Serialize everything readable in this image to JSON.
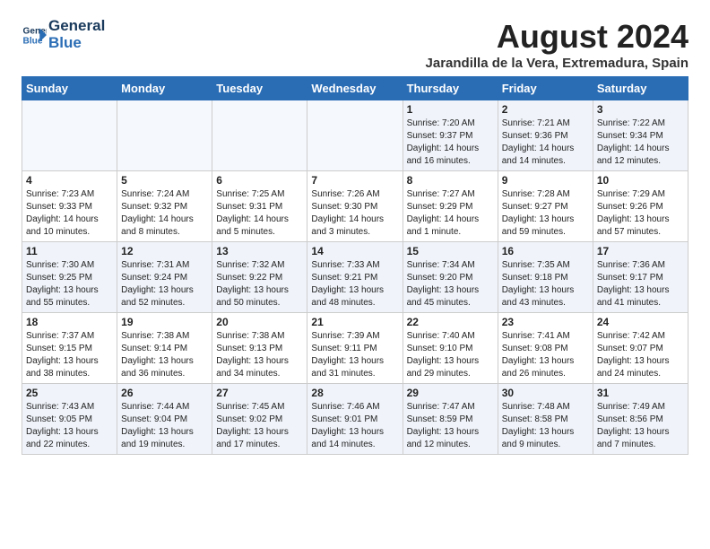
{
  "header": {
    "logo_line1": "General",
    "logo_line2": "Blue",
    "month_title": "August 2024",
    "subtitle": "Jarandilla de la Vera, Extremadura, Spain"
  },
  "weekdays": [
    "Sunday",
    "Monday",
    "Tuesday",
    "Wednesday",
    "Thursday",
    "Friday",
    "Saturday"
  ],
  "weeks": [
    [
      {
        "day": "",
        "info": ""
      },
      {
        "day": "",
        "info": ""
      },
      {
        "day": "",
        "info": ""
      },
      {
        "day": "",
        "info": ""
      },
      {
        "day": "1",
        "info": "Sunrise: 7:20 AM\nSunset: 9:37 PM\nDaylight: 14 hours\nand 16 minutes."
      },
      {
        "day": "2",
        "info": "Sunrise: 7:21 AM\nSunset: 9:36 PM\nDaylight: 14 hours\nand 14 minutes."
      },
      {
        "day": "3",
        "info": "Sunrise: 7:22 AM\nSunset: 9:34 PM\nDaylight: 14 hours\nand 12 minutes."
      }
    ],
    [
      {
        "day": "4",
        "info": "Sunrise: 7:23 AM\nSunset: 9:33 PM\nDaylight: 14 hours\nand 10 minutes."
      },
      {
        "day": "5",
        "info": "Sunrise: 7:24 AM\nSunset: 9:32 PM\nDaylight: 14 hours\nand 8 minutes."
      },
      {
        "day": "6",
        "info": "Sunrise: 7:25 AM\nSunset: 9:31 PM\nDaylight: 14 hours\nand 5 minutes."
      },
      {
        "day": "7",
        "info": "Sunrise: 7:26 AM\nSunset: 9:30 PM\nDaylight: 14 hours\nand 3 minutes."
      },
      {
        "day": "8",
        "info": "Sunrise: 7:27 AM\nSunset: 9:29 PM\nDaylight: 14 hours\nand 1 minute."
      },
      {
        "day": "9",
        "info": "Sunrise: 7:28 AM\nSunset: 9:27 PM\nDaylight: 13 hours\nand 59 minutes."
      },
      {
        "day": "10",
        "info": "Sunrise: 7:29 AM\nSunset: 9:26 PM\nDaylight: 13 hours\nand 57 minutes."
      }
    ],
    [
      {
        "day": "11",
        "info": "Sunrise: 7:30 AM\nSunset: 9:25 PM\nDaylight: 13 hours\nand 55 minutes."
      },
      {
        "day": "12",
        "info": "Sunrise: 7:31 AM\nSunset: 9:24 PM\nDaylight: 13 hours\nand 52 minutes."
      },
      {
        "day": "13",
        "info": "Sunrise: 7:32 AM\nSunset: 9:22 PM\nDaylight: 13 hours\nand 50 minutes."
      },
      {
        "day": "14",
        "info": "Sunrise: 7:33 AM\nSunset: 9:21 PM\nDaylight: 13 hours\nand 48 minutes."
      },
      {
        "day": "15",
        "info": "Sunrise: 7:34 AM\nSunset: 9:20 PM\nDaylight: 13 hours\nand 45 minutes."
      },
      {
        "day": "16",
        "info": "Sunrise: 7:35 AM\nSunset: 9:18 PM\nDaylight: 13 hours\nand 43 minutes."
      },
      {
        "day": "17",
        "info": "Sunrise: 7:36 AM\nSunset: 9:17 PM\nDaylight: 13 hours\nand 41 minutes."
      }
    ],
    [
      {
        "day": "18",
        "info": "Sunrise: 7:37 AM\nSunset: 9:15 PM\nDaylight: 13 hours\nand 38 minutes."
      },
      {
        "day": "19",
        "info": "Sunrise: 7:38 AM\nSunset: 9:14 PM\nDaylight: 13 hours\nand 36 minutes."
      },
      {
        "day": "20",
        "info": "Sunrise: 7:38 AM\nSunset: 9:13 PM\nDaylight: 13 hours\nand 34 minutes."
      },
      {
        "day": "21",
        "info": "Sunrise: 7:39 AM\nSunset: 9:11 PM\nDaylight: 13 hours\nand 31 minutes."
      },
      {
        "day": "22",
        "info": "Sunrise: 7:40 AM\nSunset: 9:10 PM\nDaylight: 13 hours\nand 29 minutes."
      },
      {
        "day": "23",
        "info": "Sunrise: 7:41 AM\nSunset: 9:08 PM\nDaylight: 13 hours\nand 26 minutes."
      },
      {
        "day": "24",
        "info": "Sunrise: 7:42 AM\nSunset: 9:07 PM\nDaylight: 13 hours\nand 24 minutes."
      }
    ],
    [
      {
        "day": "25",
        "info": "Sunrise: 7:43 AM\nSunset: 9:05 PM\nDaylight: 13 hours\nand 22 minutes."
      },
      {
        "day": "26",
        "info": "Sunrise: 7:44 AM\nSunset: 9:04 PM\nDaylight: 13 hours\nand 19 minutes."
      },
      {
        "day": "27",
        "info": "Sunrise: 7:45 AM\nSunset: 9:02 PM\nDaylight: 13 hours\nand 17 minutes."
      },
      {
        "day": "28",
        "info": "Sunrise: 7:46 AM\nSunset: 9:01 PM\nDaylight: 13 hours\nand 14 minutes."
      },
      {
        "day": "29",
        "info": "Sunrise: 7:47 AM\nSunset: 8:59 PM\nDaylight: 13 hours\nand 12 minutes."
      },
      {
        "day": "30",
        "info": "Sunrise: 7:48 AM\nSunset: 8:58 PM\nDaylight: 13 hours\nand 9 minutes."
      },
      {
        "day": "31",
        "info": "Sunrise: 7:49 AM\nSunset: 8:56 PM\nDaylight: 13 hours\nand 7 minutes."
      }
    ]
  ]
}
